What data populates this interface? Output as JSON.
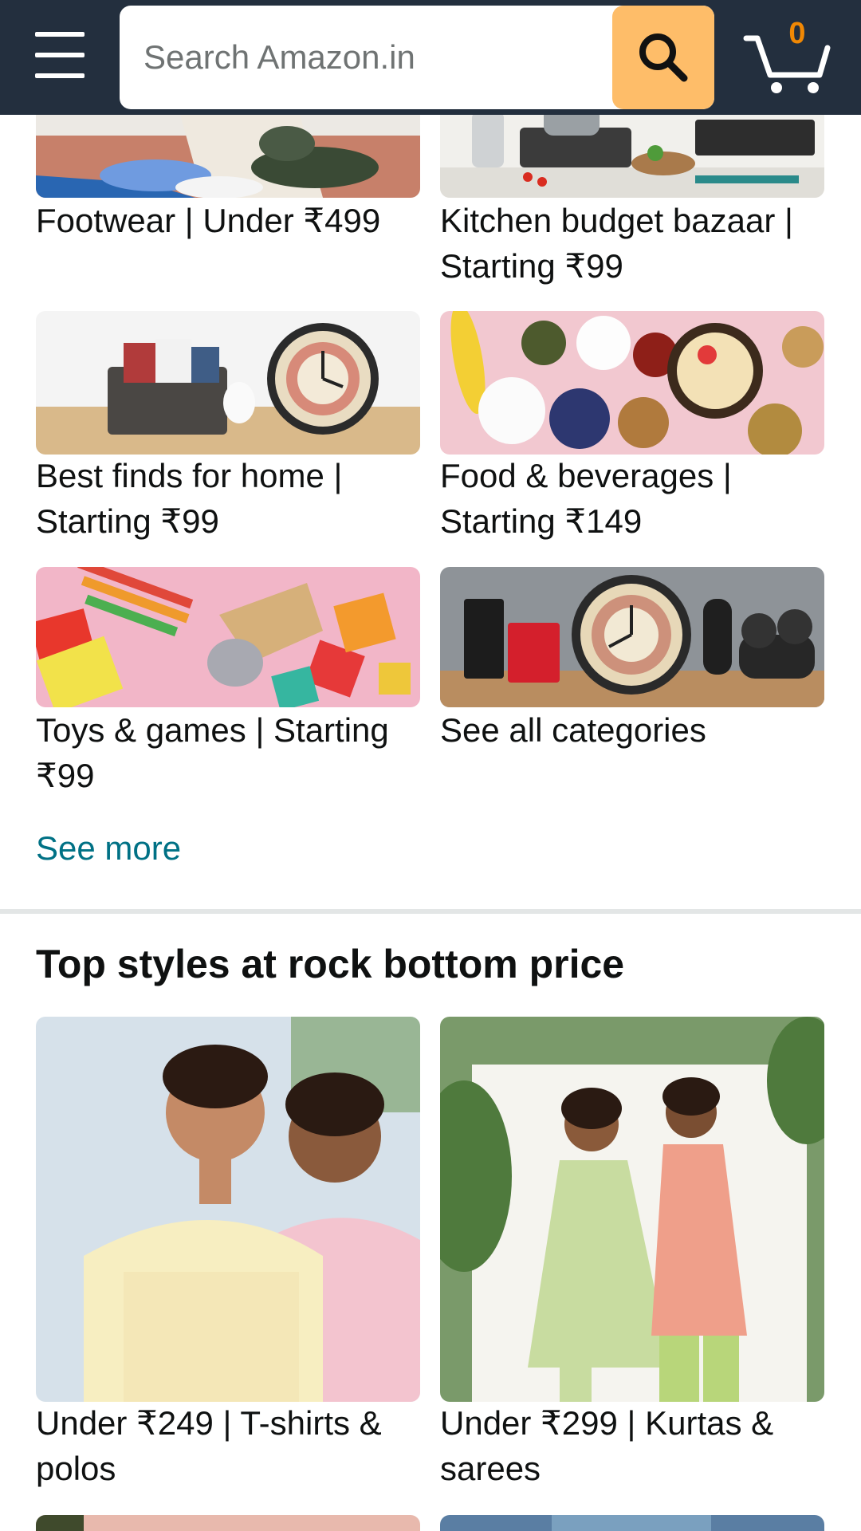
{
  "header": {
    "search_placeholder": "Search Amazon.in",
    "cart_count": "0",
    "colors": {
      "bar": "#232f3e",
      "search_button": "#febd69",
      "cart_count": "#f08804"
    }
  },
  "categories": [
    {
      "label": "Footwear | Under ₹499",
      "image": "footwear-photo"
    },
    {
      "label": "Kitchen budget bazaar | Starting ₹99",
      "image": "kitchen-photo"
    },
    {
      "label": "Best finds for home | Starting ₹99",
      "image": "home-finds-photo"
    },
    {
      "label": "Food & beverages | Starting ₹149",
      "image": "food-photo"
    },
    {
      "label": "Toys & games | Starting ₹99",
      "image": "toys-photo"
    },
    {
      "label": "See all categories",
      "image": "all-categories-photo"
    }
  ],
  "see_more": "See more",
  "section": {
    "title": "Top styles at rock bottom price",
    "items": [
      {
        "label": "Under ₹249 | T-shirts & polos",
        "image": "tshirts-photo"
      },
      {
        "label": "Under ₹299 | Kurtas & sarees",
        "image": "kurtas-photo"
      }
    ]
  }
}
